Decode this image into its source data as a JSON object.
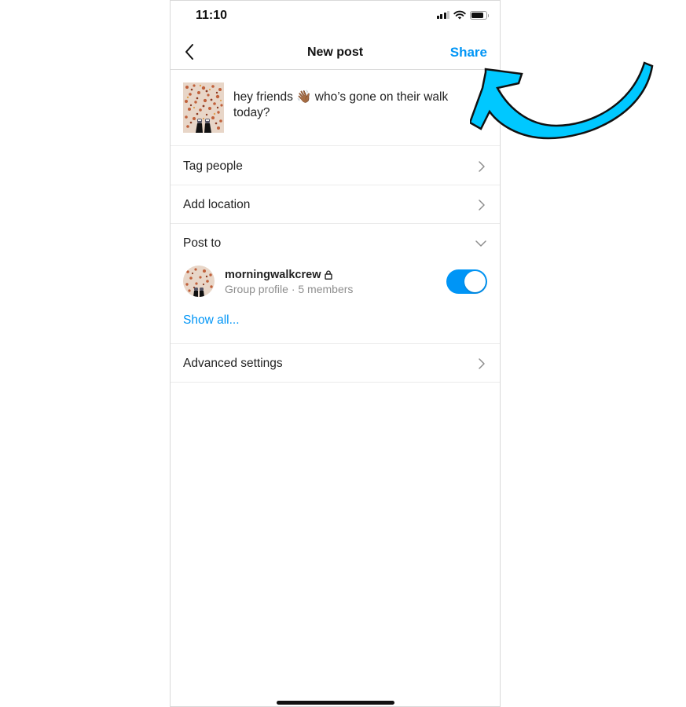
{
  "status_bar": {
    "time": "11:10",
    "icons": [
      "cellular-signal-icon",
      "wifi-icon",
      "battery-icon"
    ]
  },
  "nav": {
    "back_icon": "chevron-left-icon",
    "title": "New post",
    "share_label": "Share"
  },
  "caption": {
    "text_before_emoji": "hey friends ",
    "emoji": "👋🏾",
    "text_after_emoji": " who’s gone on their walk today?"
  },
  "rows": {
    "tag_people": "Tag people",
    "add_location": "Add location",
    "post_to": "Post to",
    "advanced_settings": "Advanced settings"
  },
  "group": {
    "name": "morningwalkcrew",
    "lock_icon": "lock-icon",
    "subtitle": "Group profile · 5 members",
    "toggle_on": true
  },
  "show_all_label": "Show all...",
  "colors": {
    "accent": "#0095f6",
    "annotation_arrow": "#00c8ff",
    "secondary_text": "#8e8e8e",
    "divider": "#ebebeb"
  }
}
